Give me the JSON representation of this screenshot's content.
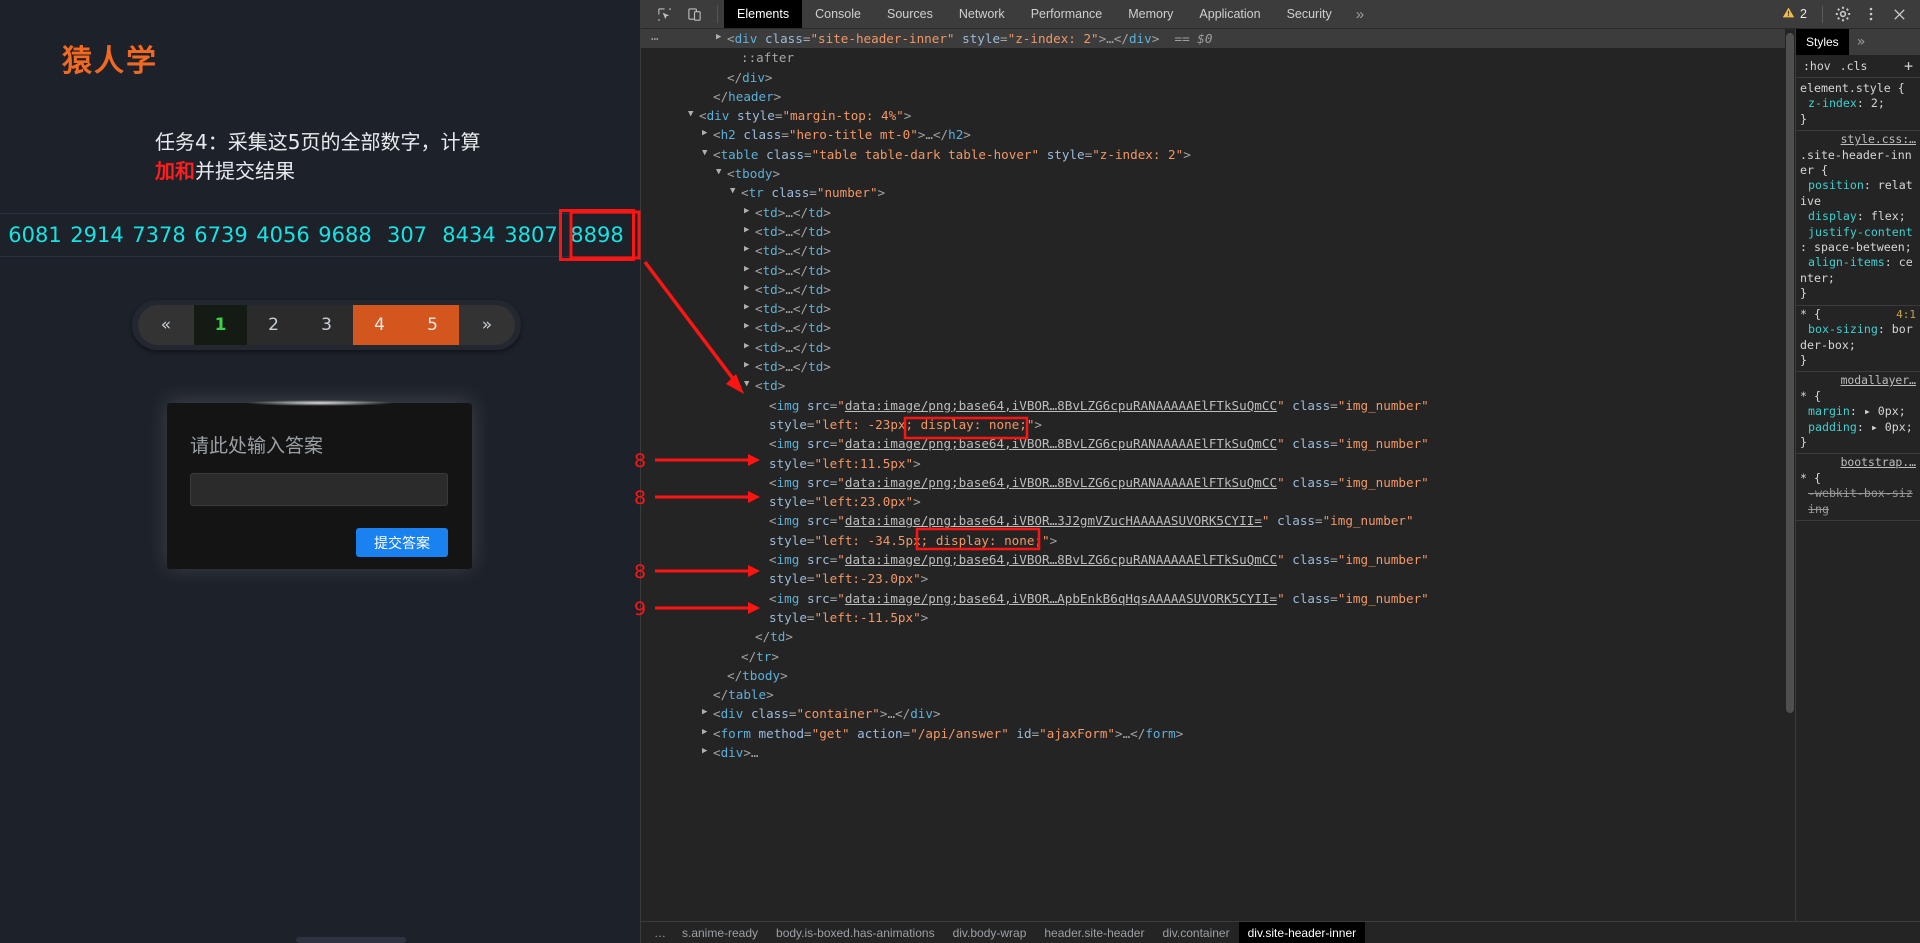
{
  "page": {
    "brand": "猿人学",
    "task_title_part1": "任务4：采集这5页的全部数字，计",
    "task_title_part2": "算",
    "task_title_highlight": "加和",
    "task_title_part3": "并提交结果",
    "numbers": [
      "6081",
      "2914",
      "7378",
      "6739",
      "4056",
      "9688",
      "307",
      "8434",
      "3807",
      "8898"
    ],
    "highlighted_number": "8898",
    "pagination": {
      "prev": "«",
      "next": "»",
      "pages": [
        "1",
        "2",
        "3",
        "4",
        "5"
      ],
      "current": "1",
      "hot": [
        "4",
        "5"
      ]
    },
    "answer": {
      "label": "请此处输入答案",
      "input_value": "",
      "input_placeholder": "",
      "submit_label": "提交答案"
    }
  },
  "devtools": {
    "icons": {
      "inspect": "inspect-element-icon",
      "device": "device-toolbar-icon",
      "settings": "gear-icon",
      "kebab": "more-options-icon",
      "close": "close-icon",
      "warning": "warning-triangle-icon"
    },
    "tabs": [
      {
        "label": "Elements",
        "active": true
      },
      {
        "label": "Console",
        "active": false
      },
      {
        "label": "Sources",
        "active": false
      },
      {
        "label": "Network",
        "active": false
      },
      {
        "label": "Performance",
        "active": false
      },
      {
        "label": "Memory",
        "active": false
      },
      {
        "label": "Application",
        "active": false
      },
      {
        "label": "Security",
        "active": false
      }
    ],
    "tabs_overflow": "»",
    "warning_count": "2",
    "dom_lines": [
      {
        "indent": 0,
        "selected": true,
        "tri": "right",
        "html": "<span class=\"punc\">&lt;</span><span class=\"tag\">div</span> <span class=\"attr\">class</span><span class=\"punc\">=</span><span class=\"val\">\"site-header-inner\"</span> <span class=\"attr\">style</span><span class=\"punc\">=</span><span class=\"val\">\"z-index: 2\"</span><span class=\"punc\">&gt;</span><span class=\"punc\">…&lt;/</span><span class=\"tag\">div</span><span class=\"punc\">&gt;</span>  <span class=\"eqid\">== $0</span>"
      },
      {
        "indent": 1,
        "selected": false,
        "tri": "",
        "html": "<span class=\"pseudo\">::after</span>"
      },
      {
        "indent": 0,
        "selected": false,
        "tri": "",
        "html": "<span class=\"punc\">&lt;/</span><span class=\"tag\">div</span><span class=\"punc\">&gt;</span>"
      },
      {
        "indent": -1,
        "selected": false,
        "tri": "",
        "html": "<span class=\"punc\">&lt;/</span><span class=\"tag\">header</span><span class=\"punc\">&gt;</span>"
      },
      {
        "indent": -2,
        "selected": false,
        "tri": "down",
        "html": "<span class=\"punc\">&lt;</span><span class=\"tag\">div</span> <span class=\"attr\">style</span><span class=\"punc\">=</span><span class=\"val\">\"margin-top: 4%\"</span><span class=\"punc\">&gt;</span>"
      },
      {
        "indent": -1,
        "selected": false,
        "tri": "right",
        "html": "<span class=\"punc\">&lt;</span><span class=\"tag\">h2</span> <span class=\"attr\">class</span><span class=\"punc\">=</span><span class=\"val\">\"hero-title mt-0\"</span><span class=\"punc\">&gt;…&lt;/</span><span class=\"tag\">h2</span><span class=\"punc\">&gt;</span>"
      },
      {
        "indent": -1,
        "selected": false,
        "tri": "down",
        "html": "<span class=\"punc\">&lt;</span><span class=\"tag\">table</span> <span class=\"attr\">class</span><span class=\"punc\">=</span><span class=\"val\">\"table table-dark table-hover\"</span> <span class=\"attr\">style</span><span class=\"punc\">=</span><span class=\"val\">\"z-index: 2\"</span><span class=\"punc\">&gt;</span>"
      },
      {
        "indent": 0,
        "selected": false,
        "tri": "down",
        "html": "<span class=\"punc\">&lt;</span><span class=\"tag\">tbody</span><span class=\"punc\">&gt;</span>"
      },
      {
        "indent": 1,
        "selected": false,
        "tri": "down",
        "html": "<span class=\"punc\">&lt;</span><span class=\"tag\">tr</span> <span class=\"attr\">class</span><span class=\"punc\">=</span><span class=\"val\">\"number\"</span><span class=\"punc\">&gt;</span>"
      },
      {
        "indent": 2,
        "selected": false,
        "tri": "right",
        "html": "<span class=\"punc\">&lt;</span><span class=\"tag\">td</span><span class=\"punc\">&gt;…&lt;/</span><span class=\"tag\">td</span><span class=\"punc\">&gt;</span>"
      },
      {
        "indent": 2,
        "selected": false,
        "tri": "right",
        "html": "<span class=\"punc\">&lt;</span><span class=\"tag\">td</span><span class=\"punc\">&gt;…&lt;/</span><span class=\"tag\">td</span><span class=\"punc\">&gt;</span>"
      },
      {
        "indent": 2,
        "selected": false,
        "tri": "right",
        "html": "<span class=\"punc\">&lt;</span><span class=\"tag\">td</span><span class=\"punc\">&gt;…&lt;/</span><span class=\"tag\">td</span><span class=\"punc\">&gt;</span>"
      },
      {
        "indent": 2,
        "selected": false,
        "tri": "right",
        "html": "<span class=\"punc\">&lt;</span><span class=\"tag\">td</span><span class=\"punc\">&gt;…&lt;/</span><span class=\"tag\">td</span><span class=\"punc\">&gt;</span>"
      },
      {
        "indent": 2,
        "selected": false,
        "tri": "right",
        "html": "<span class=\"punc\">&lt;</span><span class=\"tag\">td</span><span class=\"punc\">&gt;…&lt;/</span><span class=\"tag\">td</span><span class=\"punc\">&gt;</span>"
      },
      {
        "indent": 2,
        "selected": false,
        "tri": "right",
        "html": "<span class=\"punc\">&lt;</span><span class=\"tag\">td</span><span class=\"punc\">&gt;…&lt;/</span><span class=\"tag\">td</span><span class=\"punc\">&gt;</span>"
      },
      {
        "indent": 2,
        "selected": false,
        "tri": "right",
        "html": "<span class=\"punc\">&lt;</span><span class=\"tag\">td</span><span class=\"punc\">&gt;…&lt;/</span><span class=\"tag\">td</span><span class=\"punc\">&gt;</span>"
      },
      {
        "indent": 2,
        "selected": false,
        "tri": "right",
        "html": "<span class=\"punc\">&lt;</span><span class=\"tag\">td</span><span class=\"punc\">&gt;…&lt;/</span><span class=\"tag\">td</span><span class=\"punc\">&gt;</span>"
      },
      {
        "indent": 2,
        "selected": false,
        "tri": "right",
        "html": "<span class=\"punc\">&lt;</span><span class=\"tag\">td</span><span class=\"punc\">&gt;…&lt;/</span><span class=\"tag\">td</span><span class=\"punc\">&gt;</span>"
      },
      {
        "indent": 2,
        "selected": false,
        "tri": "down",
        "html": "<span class=\"punc\">&lt;</span><span class=\"tag\">td</span><span class=\"punc\">&gt;</span>"
      },
      {
        "indent": 3,
        "selected": false,
        "tri": "",
        "html": "<span class=\"punc\">&lt;</span><span class=\"tag\">img</span> <span class=\"attr\">src</span><span class=\"punc\">=</span><span class=\"val\">\"</span><span class=\"lnk\">data:image/png;base64,iVBOR…8BvLZG6cpuRANAAAAAElFTkSuQmCC</span><span class=\"val\">\"</span> <span class=\"attr\">class</span><span class=\"punc\">=</span><span class=\"val\">\"img_number\"</span>"
      },
      {
        "indent": 3,
        "selected": false,
        "tri": "",
        "html": "<span class=\"attr\">style</span><span class=\"punc\">=</span><span class=\"val\">\"left: -23px; display: none;\"</span><span class=\"punc\">&gt;</span>"
      },
      {
        "indent": 3,
        "selected": false,
        "tri": "",
        "html": "<span class=\"punc\">&lt;</span><span class=\"tag\">img</span> <span class=\"attr\">src</span><span class=\"punc\">=</span><span class=\"val\">\"</span><span class=\"lnk\">data:image/png;base64,iVBOR…8BvLZG6cpuRANAAAAAElFTkSuQmCC</span><span class=\"val\">\"</span> <span class=\"attr\">class</span><span class=\"punc\">=</span><span class=\"val\">\"img_number\"</span>"
      },
      {
        "indent": 3,
        "selected": false,
        "tri": "",
        "html": "<span class=\"attr\">style</span><span class=\"punc\">=</span><span class=\"val\">\"left:11.5px\"</span><span class=\"punc\">&gt;</span>"
      },
      {
        "indent": 3,
        "selected": false,
        "tri": "",
        "html": "<span class=\"punc\">&lt;</span><span class=\"tag\">img</span> <span class=\"attr\">src</span><span class=\"punc\">=</span><span class=\"val\">\"</span><span class=\"lnk\">data:image/png;base64,iVBOR…8BvLZG6cpuRANAAAAAElFTkSuQmCC</span><span class=\"val\">\"</span> <span class=\"attr\">class</span><span class=\"punc\">=</span><span class=\"val\">\"img_number\"</span>"
      },
      {
        "indent": 3,
        "selected": false,
        "tri": "",
        "html": "<span class=\"attr\">style</span><span class=\"punc\">=</span><span class=\"val\">\"left:23.0px\"</span><span class=\"punc\">&gt;</span>"
      },
      {
        "indent": 3,
        "selected": false,
        "tri": "",
        "html": "<span class=\"punc\">&lt;</span><span class=\"tag\">img</span> <span class=\"attr\">src</span><span class=\"punc\">=</span><span class=\"val\">\"</span><span class=\"lnk\">data:image/png;base64,iVBOR…3J2gmVZucHAAAAASUVORK5CYII=</span><span class=\"val\">\"</span> <span class=\"attr\">class</span><span class=\"punc\">=</span><span class=\"val\">\"img_number\"</span>"
      },
      {
        "indent": 3,
        "selected": false,
        "tri": "",
        "html": "<span class=\"attr\">style</span><span class=\"punc\">=</span><span class=\"val\">\"left: -34.5px; display: none;\"</span><span class=\"punc\">&gt;</span>"
      },
      {
        "indent": 3,
        "selected": false,
        "tri": "",
        "html": "<span class=\"punc\">&lt;</span><span class=\"tag\">img</span> <span class=\"attr\">src</span><span class=\"punc\">=</span><span class=\"val\">\"</span><span class=\"lnk\">data:image/png;base64,iVBOR…8BvLZG6cpuRANAAAAAElFTkSuQmCC</span><span class=\"val\">\"</span> <span class=\"attr\">class</span><span class=\"punc\">=</span><span class=\"val\">\"img_number\"</span>"
      },
      {
        "indent": 3,
        "selected": false,
        "tri": "",
        "html": "<span class=\"attr\">style</span><span class=\"punc\">=</span><span class=\"val\">\"left:-23.0px\"</span><span class=\"punc\">&gt;</span>"
      },
      {
        "indent": 3,
        "selected": false,
        "tri": "",
        "html": "<span class=\"punc\">&lt;</span><span class=\"tag\">img</span> <span class=\"attr\">src</span><span class=\"punc\">=</span><span class=\"val\">\"</span><span class=\"lnk\">data:image/png;base64,iVBOR…ApbEnkB6qHqsAAAAASUVORK5CYII=</span><span class=\"val\">\"</span> <span class=\"attr\">class</span><span class=\"punc\">=</span><span class=\"val\">\"img_number\"</span>"
      },
      {
        "indent": 3,
        "selected": false,
        "tri": "",
        "html": "<span class=\"attr\">style</span><span class=\"punc\">=</span><span class=\"val\">\"left:-11.5px\"</span><span class=\"punc\">&gt;</span>"
      },
      {
        "indent": 2,
        "selected": false,
        "tri": "",
        "html": "<span class=\"punc\">&lt;/</span><span class=\"tag\">td</span><span class=\"punc\">&gt;</span>"
      },
      {
        "indent": 1,
        "selected": false,
        "tri": "",
        "html": "<span class=\"punc\">&lt;/</span><span class=\"tag\">tr</span><span class=\"punc\">&gt;</span>"
      },
      {
        "indent": 0,
        "selected": false,
        "tri": "",
        "html": "<span class=\"punc\">&lt;/</span><span class=\"tag\">tbody</span><span class=\"punc\">&gt;</span>"
      },
      {
        "indent": -1,
        "selected": false,
        "tri": "",
        "html": "<span class=\"punc\">&lt;/</span><span class=\"tag\">table</span><span class=\"punc\">&gt;</span>"
      },
      {
        "indent": -1,
        "selected": false,
        "tri": "right",
        "html": "<span class=\"punc\">&lt;</span><span class=\"tag\">div</span> <span class=\"attr\">class</span><span class=\"punc\">=</span><span class=\"val\">\"container\"</span><span class=\"punc\">&gt;…&lt;/</span><span class=\"tag\">div</span><span class=\"punc\">&gt;</span>"
      },
      {
        "indent": -1,
        "selected": false,
        "tri": "right",
        "html": "<span class=\"punc\">&lt;</span><span class=\"tag\">form</span> <span class=\"attr\">method</span><span class=\"punc\">=</span><span class=\"val\">\"get\"</span> <span class=\"attr\">action</span><span class=\"punc\">=</span><span class=\"val\">\"/api/answer\"</span> <span class=\"attr\">id</span><span class=\"punc\">=</span><span class=\"val\">\"ajaxForm\"</span><span class=\"punc\">&gt;…&lt;/</span><span class=\"tag\">form</span><span class=\"punc\">&gt;</span>"
      },
      {
        "indent": -1,
        "selected": false,
        "tri": "right",
        "html": "<span class=\"punc\">&lt;</span><span class=\"tag\">div</span><span class=\"punc\">&gt;…</span>"
      }
    ],
    "styles": {
      "tab_label": "Styles",
      "overflow": "»",
      "filter_hov": ":hov",
      "filter_cls": ".cls",
      "filter_plus": "+",
      "rules": [
        {
          "origin": "",
          "selector": "element.style {",
          "decls": [
            {
              "prop": "z-index",
              "value": "2;"
            }
          ],
          "close": "}"
        },
        {
          "origin": "style.css:…",
          "selector": ".site-header-inner {",
          "decls": [
            {
              "prop": "position",
              "value": "relative"
            },
            {
              "prop": "display",
              "value": "flex;"
            },
            {
              "prop": "justify-content",
              "value": "space-between;"
            },
            {
              "prop": "align-items",
              "value": "center;"
            }
          ],
          "close": "}"
        },
        {
          "origin": "",
          "selector": "* {",
          "ratio": "4:1",
          "decls": [
            {
              "prop": "box-sizing",
              "value": "border-box;"
            }
          ],
          "close": "}"
        },
        {
          "origin": "modallayer…",
          "selector": "* {",
          "decls": [
            {
              "prop": "margin",
              "value": "▸ 0px;"
            },
            {
              "prop": "padding",
              "value": "▸ 0px;"
            }
          ],
          "close": "}"
        },
        {
          "origin": "bootstrap.…",
          "selector": "* {",
          "decls": [
            {
              "prop": "-webkit-box-sizing",
              "value": "",
              "strike": true
            }
          ],
          "close": ""
        }
      ]
    },
    "breadcrumb": {
      "ellipsis": "…",
      "items": [
        {
          "label": "s.anime-ready",
          "active": false
        },
        {
          "label": "body.is-boxed.has-animations",
          "active": false
        },
        {
          "label": "div.body-wrap",
          "active": false
        },
        {
          "label": "header.site-header",
          "active": false
        },
        {
          "label": "div.container",
          "active": false
        },
        {
          "label": "div.site-header-inner",
          "active": true
        }
      ]
    }
  },
  "annotations": {
    "digits": [
      "8",
      "8",
      "8",
      "9"
    ]
  }
}
